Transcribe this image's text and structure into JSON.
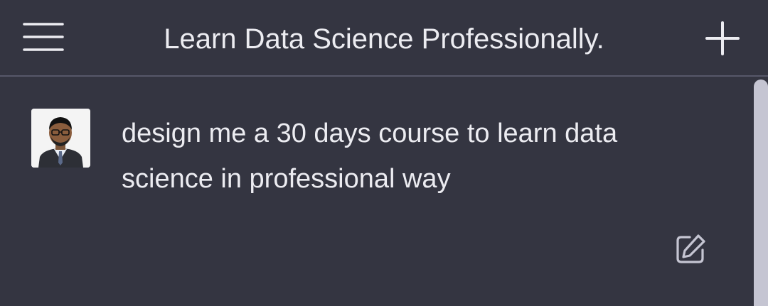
{
  "header": {
    "title": "Learn Data Science Professionally.",
    "menu_icon": "hamburger-menu-icon",
    "new_chat_icon": "plus-icon"
  },
  "message": {
    "role": "user",
    "avatar": "user-avatar-photo",
    "text": "design me a 30 days course to learn data science in professional way",
    "edit_icon": "edit-icon"
  },
  "colors": {
    "background": "#343541",
    "divider": "#565869",
    "text": "#ececf1",
    "scrollbar_thumb": "#c5c5d2"
  }
}
